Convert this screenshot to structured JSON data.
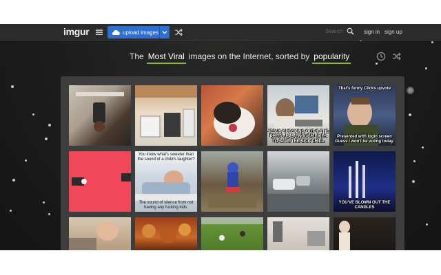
{
  "topbar": {
    "logo": "imgur",
    "upload_label": "upload images",
    "search_label": "Search",
    "signin_label": "sign in",
    "signup_label": "sign up"
  },
  "headline": {
    "prefix": "The",
    "sort_dropdown": "Most Viral",
    "middle": "images on the Internet, sorted by",
    "order_dropdown": "popularity"
  },
  "icons": {
    "menu": "menu-icon",
    "upload": "cloud-upload-icon",
    "upload_menu": "chevron-down-icon",
    "random": "shuffle-icon",
    "search": "search-icon",
    "time": "clock-icon"
  },
  "colors": {
    "background": "#1c1c1c",
    "topbar": "#2c2c2c",
    "upload_button": "#2e6fcf",
    "dropdown_underline": "#85bf25",
    "gallery_panel": "#3d3d3d"
  },
  "gallery": {
    "tiles": [
      {
        "top": "",
        "bottom": ""
      },
      {
        "top": "",
        "bottom": ""
      },
      {
        "top": "",
        "bottom": ""
      },
      {
        "top": "",
        "bottom": "JESUS CHECKING OUT IF THE PHOTO HAS ENOUGH LIKES TO SAVE THE SICK CHILD"
      },
      {
        "top": "That's funny Clicks upvote",
        "bottom": "Presented with login screen Guess I won't be voting today."
      },
      {
        "top": "",
        "bottom": ""
      },
      {
        "top": "You know what's sweeter than the sound of a child's laughter?",
        "bottom": "The sound of silence from not having any fucking kids."
      },
      {
        "top": "",
        "bottom": ""
      },
      {
        "top": "",
        "bottom": ""
      },
      {
        "top": "",
        "bottom": "YOU'VE BLOWN OUT THE CANDLES"
      },
      {
        "top": "",
        "bottom": ""
      },
      {
        "top": "",
        "bottom": ""
      },
      {
        "top": "",
        "bottom": ""
      },
      {
        "top": "",
        "bottom": ""
      },
      {
        "top": "",
        "bottom": ""
      }
    ]
  }
}
